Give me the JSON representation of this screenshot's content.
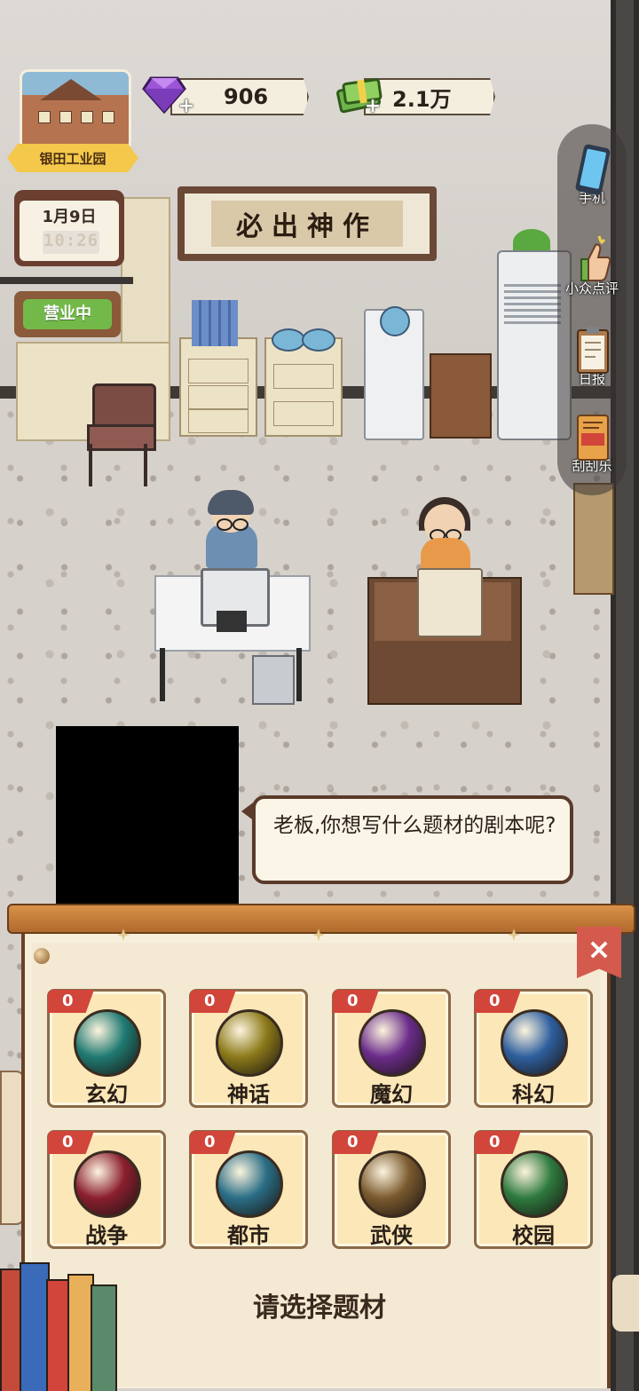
{
  "location": {
    "name": "银田工业园"
  },
  "resources": {
    "gems": {
      "value": "906",
      "icon": "gem-icon"
    },
    "cash": {
      "value": "2.1万",
      "icon": "cash-icon"
    }
  },
  "calendar": {
    "date": "1月9日",
    "time": "10:26"
  },
  "shop_status": "营业中",
  "calligraphy": "必出神作",
  "side_menu": [
    {
      "label": "手机",
      "icon": "phone-icon"
    },
    {
      "label": "小众点评",
      "icon": "thumbs-up-icon"
    },
    {
      "label": "日报",
      "icon": "clipboard-icon"
    },
    {
      "label": "刮刮乐",
      "icon": "scratch-card-icon"
    }
  ],
  "dialog": {
    "text": "老板,你想写什么题材的剧本呢?"
  },
  "genre_panel": {
    "prompt": "请选择题材",
    "close_symbol": "×",
    "genres": [
      {
        "label": "玄幻",
        "count": "0",
        "icon": "meditation-icon",
        "color": "#1f7a72"
      },
      {
        "label": "神话",
        "count": "0",
        "icon": "halo-icon",
        "color": "#8c7a1a"
      },
      {
        "label": "魔幻",
        "count": "0",
        "icon": "hexagram-icon",
        "color": "#6a2c8a"
      },
      {
        "label": "科幻",
        "count": "0",
        "icon": "ufo-icon",
        "color": "#2e5f9e"
      },
      {
        "label": "战争",
        "count": "0",
        "icon": "pistol-icon",
        "color": "#8a1f2e"
      },
      {
        "label": "都市",
        "count": "0",
        "icon": "city-icon",
        "color": "#2a6e86"
      },
      {
        "label": "武侠",
        "count": "0",
        "icon": "bamboo-hat-icon",
        "color": "#7a5a2e"
      },
      {
        "label": "校园",
        "count": "0",
        "icon": "uniform-icon",
        "color": "#2e7a3e"
      }
    ]
  },
  "colors": {
    "accent_red": "#d1453b",
    "panel_bg": "#f7efdb",
    "wood": "#b06a2c"
  }
}
